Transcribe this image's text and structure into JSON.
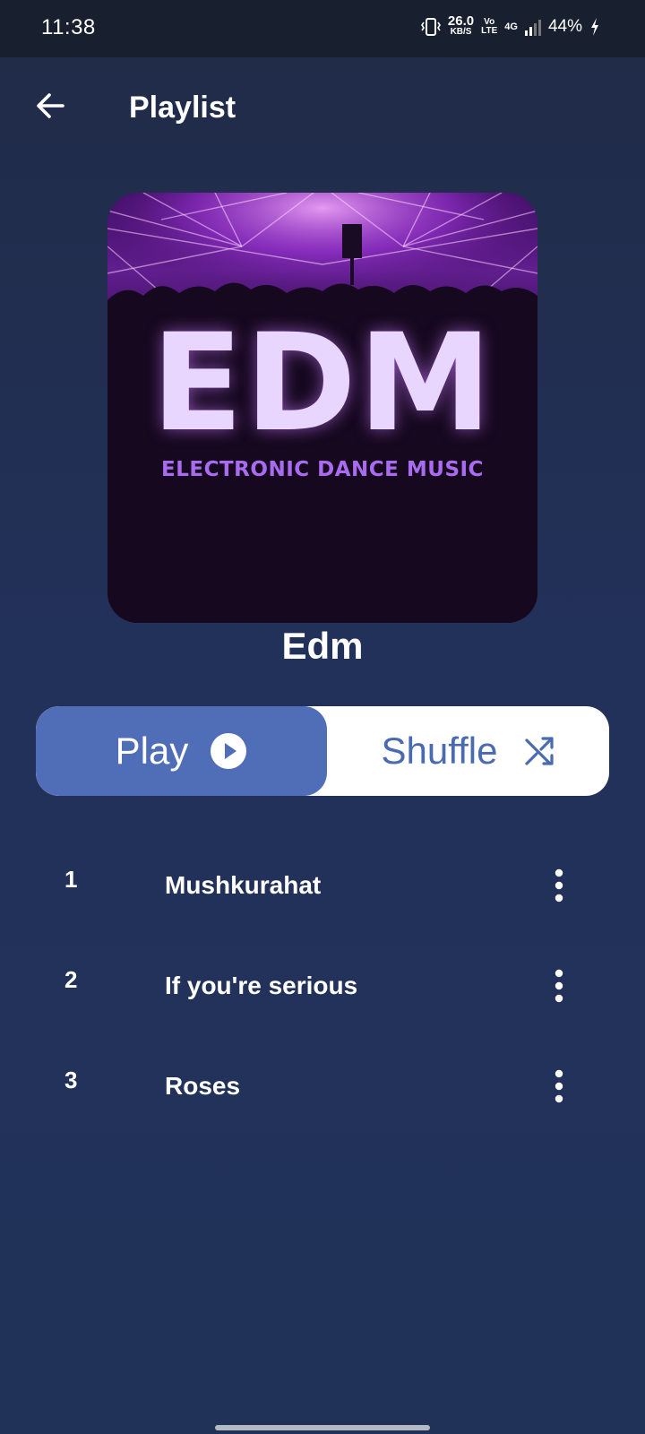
{
  "status_bar": {
    "time": "11:38",
    "net_speed_value": "26.0",
    "net_speed_unit": "KB/S",
    "volte_top": "Vo",
    "volte_bottom": "LTE",
    "network": "4G",
    "battery": "44%",
    "icons": [
      "vibrate-icon",
      "signal-icon",
      "charging-icon"
    ]
  },
  "header": {
    "title": "Playlist",
    "back_icon": "arrow-left-icon"
  },
  "cover": {
    "big_text": "EDM",
    "sub_text": "ELECTRONIC DANCE MUSIC"
  },
  "playlist": {
    "name": "Edm"
  },
  "controls": {
    "play_label": "Play",
    "shuffle_label": "Shuffle",
    "play_icon": "play-circle-icon",
    "shuffle_icon": "shuffle-icon",
    "colors": {
      "play_bg": "#4f6eb7",
      "shuffle_bg": "#ffffff",
      "shuffle_text": "#4a6bb0"
    }
  },
  "tracks": [
    {
      "number": "1",
      "title": "Mushkurahat"
    },
    {
      "number": "2",
      "title": "If you're serious"
    },
    {
      "number": "3",
      "title": "Roses"
    }
  ]
}
